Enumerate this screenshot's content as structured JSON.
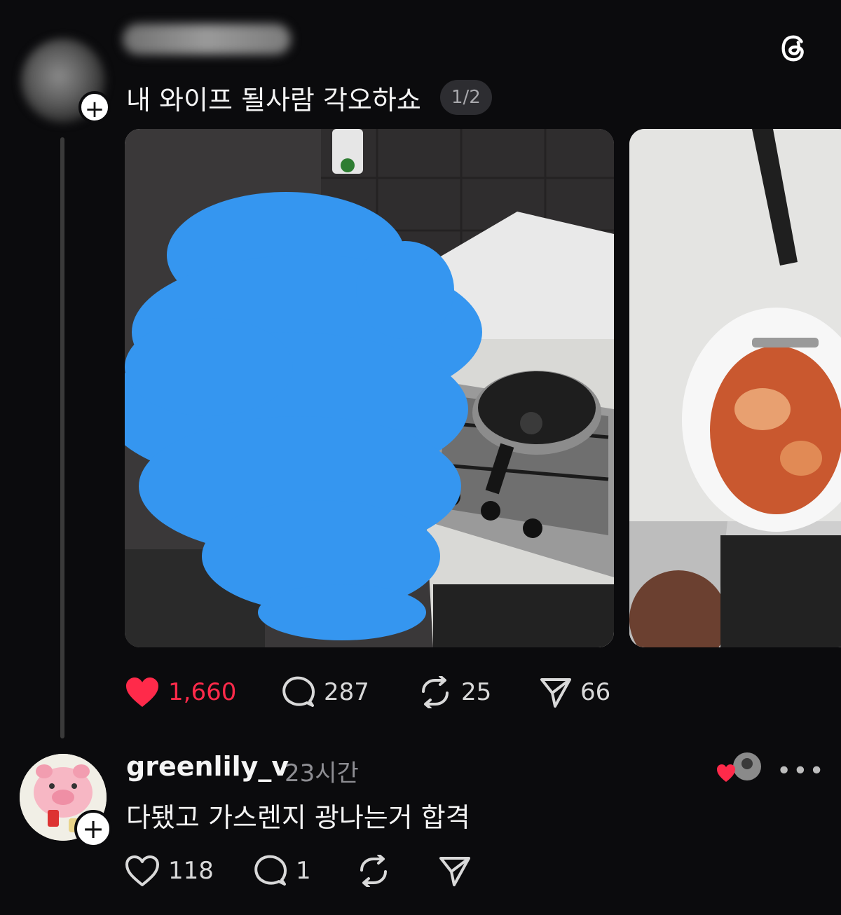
{
  "post": {
    "text": "내 와이프 될사람 각오하쇼",
    "page_indicator": "1/2",
    "stats": {
      "likes": "1,660",
      "comments": "287",
      "reposts": "25",
      "shares": "66"
    },
    "liked": true
  },
  "reply": {
    "username": "greenlily_v",
    "time": "23시간",
    "text": "다됐고 가스렌지 광나는거 합격",
    "stats": {
      "likes": "118",
      "comments": "1"
    }
  },
  "icons": {
    "app": "threads-logo-icon",
    "like": "heart-icon",
    "comment": "comment-bubble-icon",
    "repost": "repost-icon",
    "share": "send-icon",
    "follow": "plus-icon",
    "more": "ellipsis-icon"
  },
  "colors": {
    "background": "#0b0b0d",
    "like_red": "#ff2a4a",
    "muted": "#8e8e93"
  }
}
